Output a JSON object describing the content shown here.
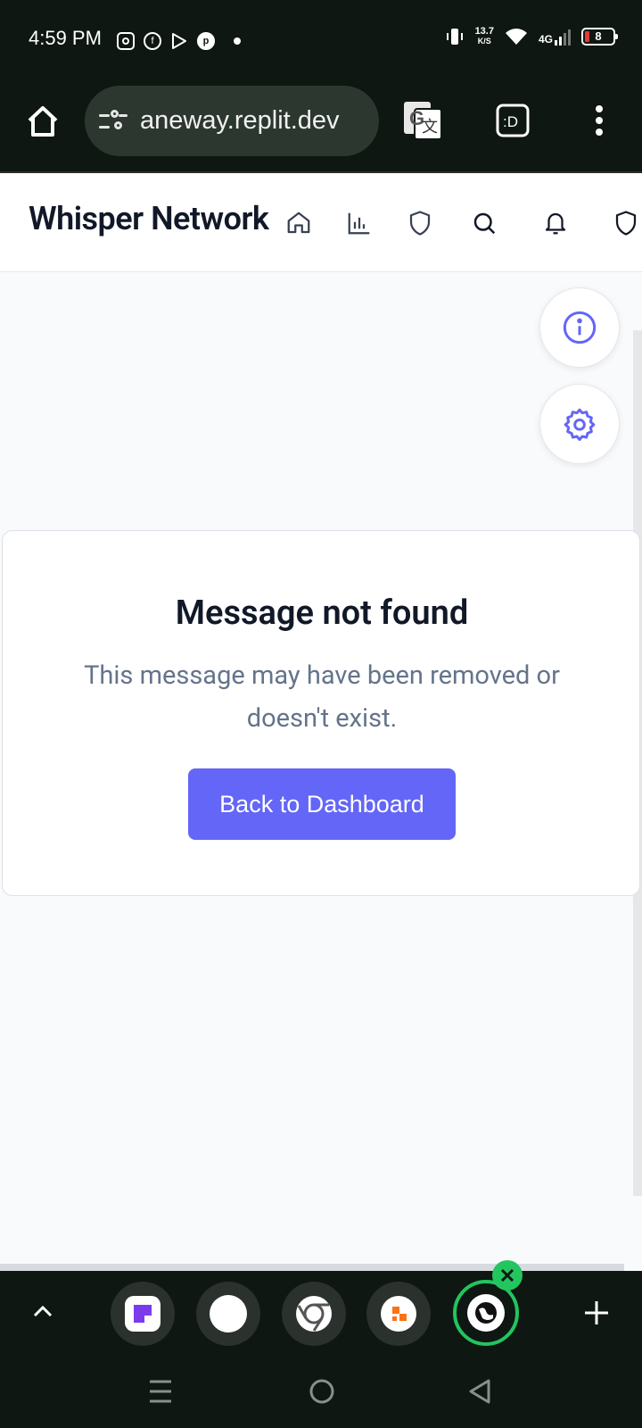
{
  "status_bar": {
    "time": "4:59 PM",
    "notification_icons": [
      "instagram-icon",
      "facebook-icon",
      "play-store-icon",
      "pinterest-icon"
    ],
    "data_rate_value": "13.7",
    "data_rate_unit": "K/S",
    "network": "4G",
    "battery": "8"
  },
  "browser": {
    "url": "aneway.replit.dev",
    "icons": [
      "home-icon",
      "site-settings-icon",
      "translate-icon",
      "extension-icon",
      "more-menu-icon"
    ]
  },
  "app": {
    "title": "Whisper Network",
    "nav_icons": [
      "home-icon",
      "chart-icon",
      "shield-icon",
      "search-icon",
      "bell-icon",
      "shield-icon"
    ]
  },
  "fab": {
    "info_icon": "info-icon",
    "settings_icon": "settings-icon"
  },
  "card": {
    "title": "Message not found",
    "description": "This message may have been removed or doesn't exist.",
    "button_label": "Back to Dashboard"
  },
  "colors": {
    "accent": "#6466f7",
    "browser_chrome": "#0e1711",
    "page_bg": "#f8fafc",
    "title_text": "#111827",
    "muted_text": "#64748b",
    "active_tab_ring": "#22c55e"
  }
}
